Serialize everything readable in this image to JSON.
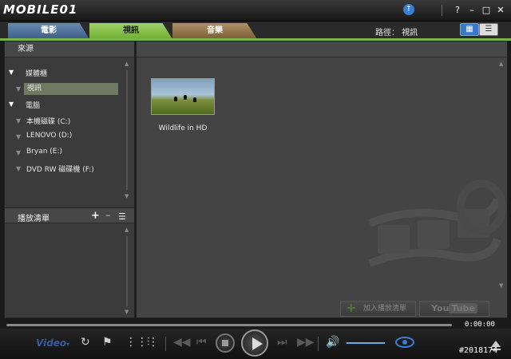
{
  "app": {
    "logo": "MOBILE01"
  },
  "window_buttons": {
    "help": "?",
    "minimize": "–",
    "maximize": "□",
    "close": "✕"
  },
  "tabs": [
    {
      "label": "電影"
    },
    {
      "label": "視訊"
    },
    {
      "label": "音樂"
    }
  ],
  "path": {
    "label": "路徑：",
    "value": "視訊"
  },
  "sidebar": {
    "source_title": "來源",
    "items": [
      {
        "label": "媒體櫃"
      },
      {
        "label": "視訊"
      },
      {
        "label": "電腦"
      },
      {
        "label": "本機磁碟 (C:)"
      },
      {
        "label": "LENOVO (D:)"
      },
      {
        "label": "Bryan (E:)"
      },
      {
        "label": "DVD RW 磁碟機 (F:)"
      }
    ],
    "playlist_title": "播放清單"
  },
  "main": {
    "videos": [
      {
        "title": "Wildlife in HD"
      }
    ],
    "add_to_playlist": "加入播放清單",
    "youtube_you": "You",
    "youtube_tube": "Tube"
  },
  "player": {
    "mode": "Video",
    "time": "0:00:00"
  },
  "watermark": "#2018174"
}
